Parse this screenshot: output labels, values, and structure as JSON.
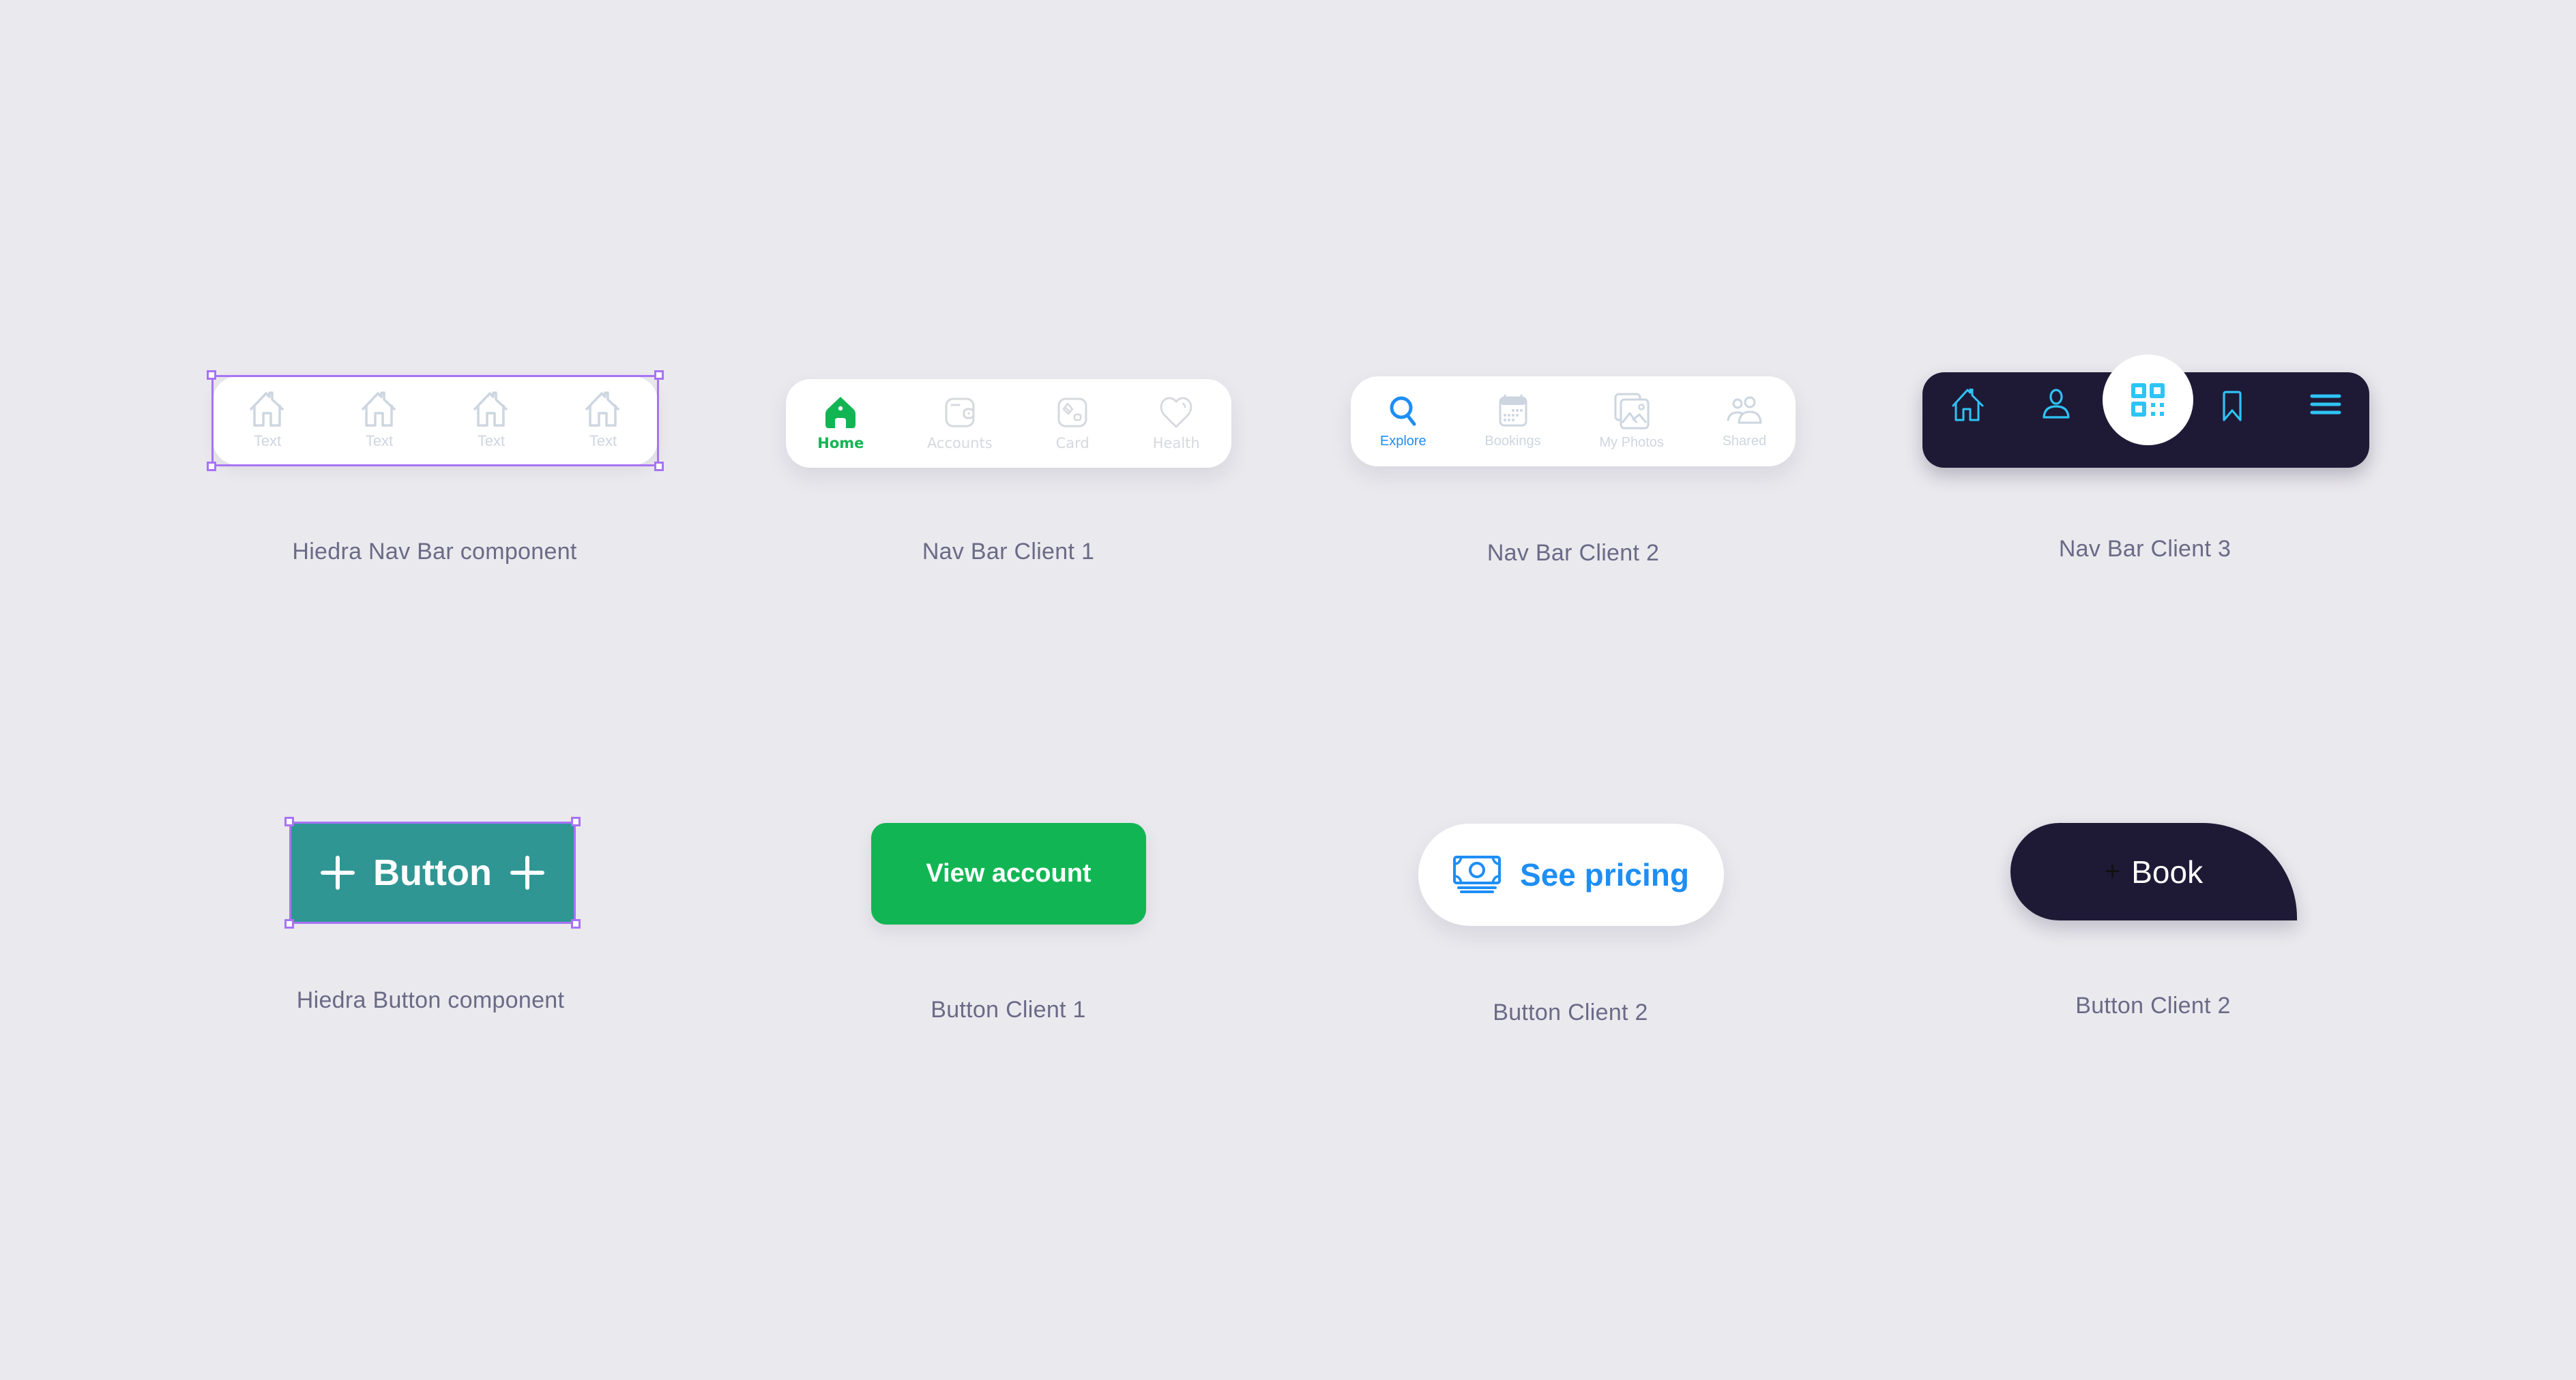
{
  "colors": {
    "background": "#eae9ee",
    "label_text": "#6b6a86",
    "selection_outline": "#a873f5",
    "hiedra_teal": "#2f9693",
    "client1_green": "#12b553",
    "client2_blue": "#1e8ef5",
    "client3_navy": "#1e1a36",
    "client3_cyan": "#2ec4f5",
    "inactive_icon": "#cdd6e0"
  },
  "nav_bars": [
    {
      "caption": "Hiedra Nav Bar component",
      "items": [
        {
          "label": "Text",
          "icon": "home-outline-icon"
        },
        {
          "label": "Text",
          "icon": "home-outline-icon"
        },
        {
          "label": "Text",
          "icon": "home-outline-icon"
        },
        {
          "label": "Text",
          "icon": "home-outline-icon"
        }
      ]
    },
    {
      "caption": "Nav Bar Client 1",
      "active_index": 0,
      "items": [
        {
          "label": "Home",
          "icon": "home-filled-icon"
        },
        {
          "label": "Accounts",
          "icon": "wallet-icon"
        },
        {
          "label": "Card",
          "icon": "card-icon"
        },
        {
          "label": "Health",
          "icon": "heart-icon"
        }
      ]
    },
    {
      "caption": "Nav Bar Client 2",
      "active_index": 0,
      "items": [
        {
          "label": "Explore",
          "icon": "search-icon"
        },
        {
          "label": "Bookings",
          "icon": "calendar-icon"
        },
        {
          "label": "My Photos",
          "icon": "photos-icon"
        },
        {
          "label": "Shared",
          "icon": "users-icon"
        }
      ]
    },
    {
      "caption": "Nav Bar Client 3",
      "items": [
        {
          "icon": "home-icon"
        },
        {
          "icon": "user-icon"
        },
        {
          "icon": "qr-code-icon"
        },
        {
          "icon": "bookmark-icon"
        },
        {
          "icon": "menu-icon"
        }
      ]
    }
  ],
  "buttons": [
    {
      "caption": "Hiedra Button component",
      "label": "Button",
      "leading_icon": "plus-icon",
      "trailing_icon": "plus-icon"
    },
    {
      "caption": "Button Client 1",
      "label": "View account"
    },
    {
      "caption": "Button Client 2",
      "label": "See pricing",
      "leading_icon": "money-icon"
    },
    {
      "caption": "Button Client 2",
      "label": "Book",
      "leading_icon": "plus-icon",
      "plus_glyph": "+"
    }
  ]
}
